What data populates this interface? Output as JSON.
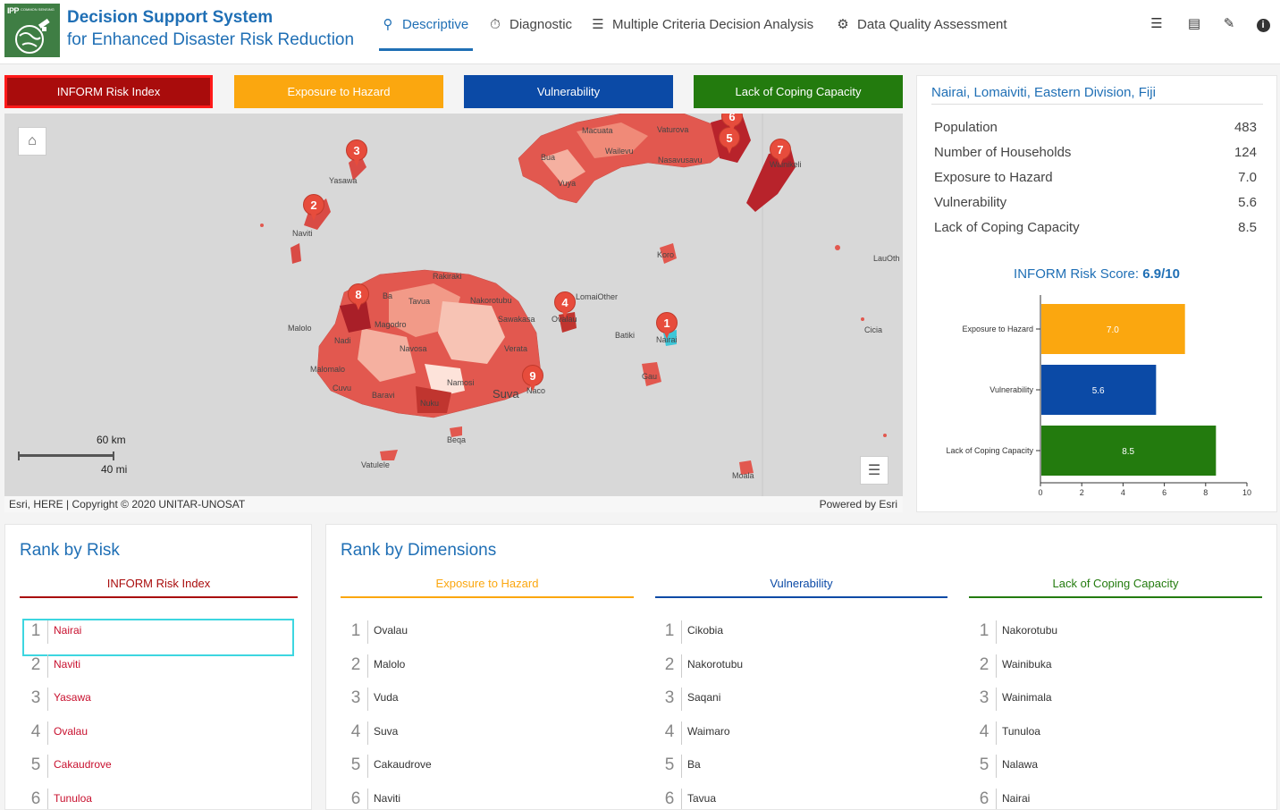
{
  "header": {
    "logo_text": "IPP",
    "logo_sub": "COMMON SENSING",
    "title": "Decision Support System",
    "subtitle": "for Enhanced Disaster Risk Reduction",
    "tabs": [
      {
        "label": "Descriptive",
        "icon": "search-icon",
        "active": true
      },
      {
        "label": "Diagnostic",
        "icon": "gauge-icon"
      },
      {
        "label": "Multiple Criteria Decision Analysis",
        "icon": "list-icon"
      },
      {
        "label": "Data Quality Assessment",
        "icon": "quality-icon"
      }
    ],
    "icons": [
      "layers-icon",
      "document-icon",
      "comment-icon",
      "info-icon"
    ]
  },
  "dimension_buttons": {
    "inform": "INFORM Risk Index",
    "exposure": "Exposure to Hazard",
    "vulnerability": "Vulnerability",
    "coping": "Lack of Coping Capacity"
  },
  "colors": {
    "inform": "#a90c0c",
    "exposure": "#fba70f",
    "vulnerability": "#0b4aa6",
    "coping": "#237b0e",
    "accent": "#1f6fb5"
  },
  "map": {
    "scale_km": "60 km",
    "scale_mi": "40 mi",
    "attribution": "Esri, HERE | Copyright © 2020 UNITAR-UNOSAT",
    "powered_by": "Powered by Esri",
    "labels": [
      "Yasawa",
      "Naviti",
      "Macuata",
      "Vaturova",
      "Wailevu",
      "Nasavusavu",
      "Bua",
      "Vuya",
      "Wainikeli",
      "Koro",
      "LauOth",
      "Rakiraki",
      "Ba",
      "Tavua",
      "Nakorotubu",
      "LomaiOther",
      "Magodro",
      "Sawakasa",
      "Ovalau",
      "Malolo",
      "Nadi",
      "Navosa",
      "Verata",
      "Batiki",
      "Nairai",
      "Cicia",
      "Malomalo",
      "Namosi",
      "Cuvu",
      "Baravi",
      "Suva",
      "Naco",
      "Gau",
      "Nuku",
      "Beqa",
      "Vatulele",
      "Moala"
    ],
    "pins": [
      "1",
      "2",
      "3",
      "4",
      "5",
      "6",
      "7",
      "8",
      "9"
    ]
  },
  "info": {
    "location": "Nairai, Lomaiviti, Eastern Division, Fiji",
    "stats": [
      {
        "label": "Population",
        "value": "483"
      },
      {
        "label": "Number of Households",
        "value": "124"
      },
      {
        "label": "Exposure to Hazard",
        "value": "7.0"
      },
      {
        "label": "Vulnerability",
        "value": "5.6"
      },
      {
        "label": "Lack of Coping Capacity",
        "value": "8.5"
      }
    ],
    "score_label": "INFORM Risk Score:",
    "score_value": "6.9/10"
  },
  "chart_data": {
    "type": "bar",
    "orientation": "horizontal",
    "categories": [
      "Exposure to Hazard",
      "Vulnerability",
      "Lack of Coping Capacity"
    ],
    "values": [
      7.0,
      5.6,
      8.5
    ],
    "value_labels": [
      "7.0",
      "5.6",
      "8.5"
    ],
    "colors": [
      "#fba70f",
      "#0b4aa6",
      "#237b0e"
    ],
    "xlim": [
      0,
      10
    ],
    "xticks": [
      0,
      2,
      4,
      6,
      8,
      10
    ],
    "grid": false
  },
  "rank_risk": {
    "title": "Rank by Risk",
    "column": "INFORM Risk Index",
    "items": [
      "Nairai",
      "Naviti",
      "Yasawa",
      "Ovalau",
      "Cakaudrove",
      "Tunuloa"
    ]
  },
  "rank_dims": {
    "title": "Rank by Dimensions",
    "columns": [
      {
        "label": "Exposure to Hazard",
        "items": [
          "Ovalau",
          "Malolo",
          "Vuda",
          "Suva",
          "Cakaudrove",
          "Naviti"
        ]
      },
      {
        "label": "Vulnerability",
        "items": [
          "Cikobia",
          "Nakorotubu",
          "Saqani",
          "Waimaro",
          "Ba",
          "Tavua"
        ]
      },
      {
        "label": "Lack of Coping Capacity",
        "items": [
          "Nakorotubu",
          "Wainibuka",
          "Wainimala",
          "Tunuloa",
          "Nalawa",
          "Nairai"
        ]
      }
    ]
  }
}
